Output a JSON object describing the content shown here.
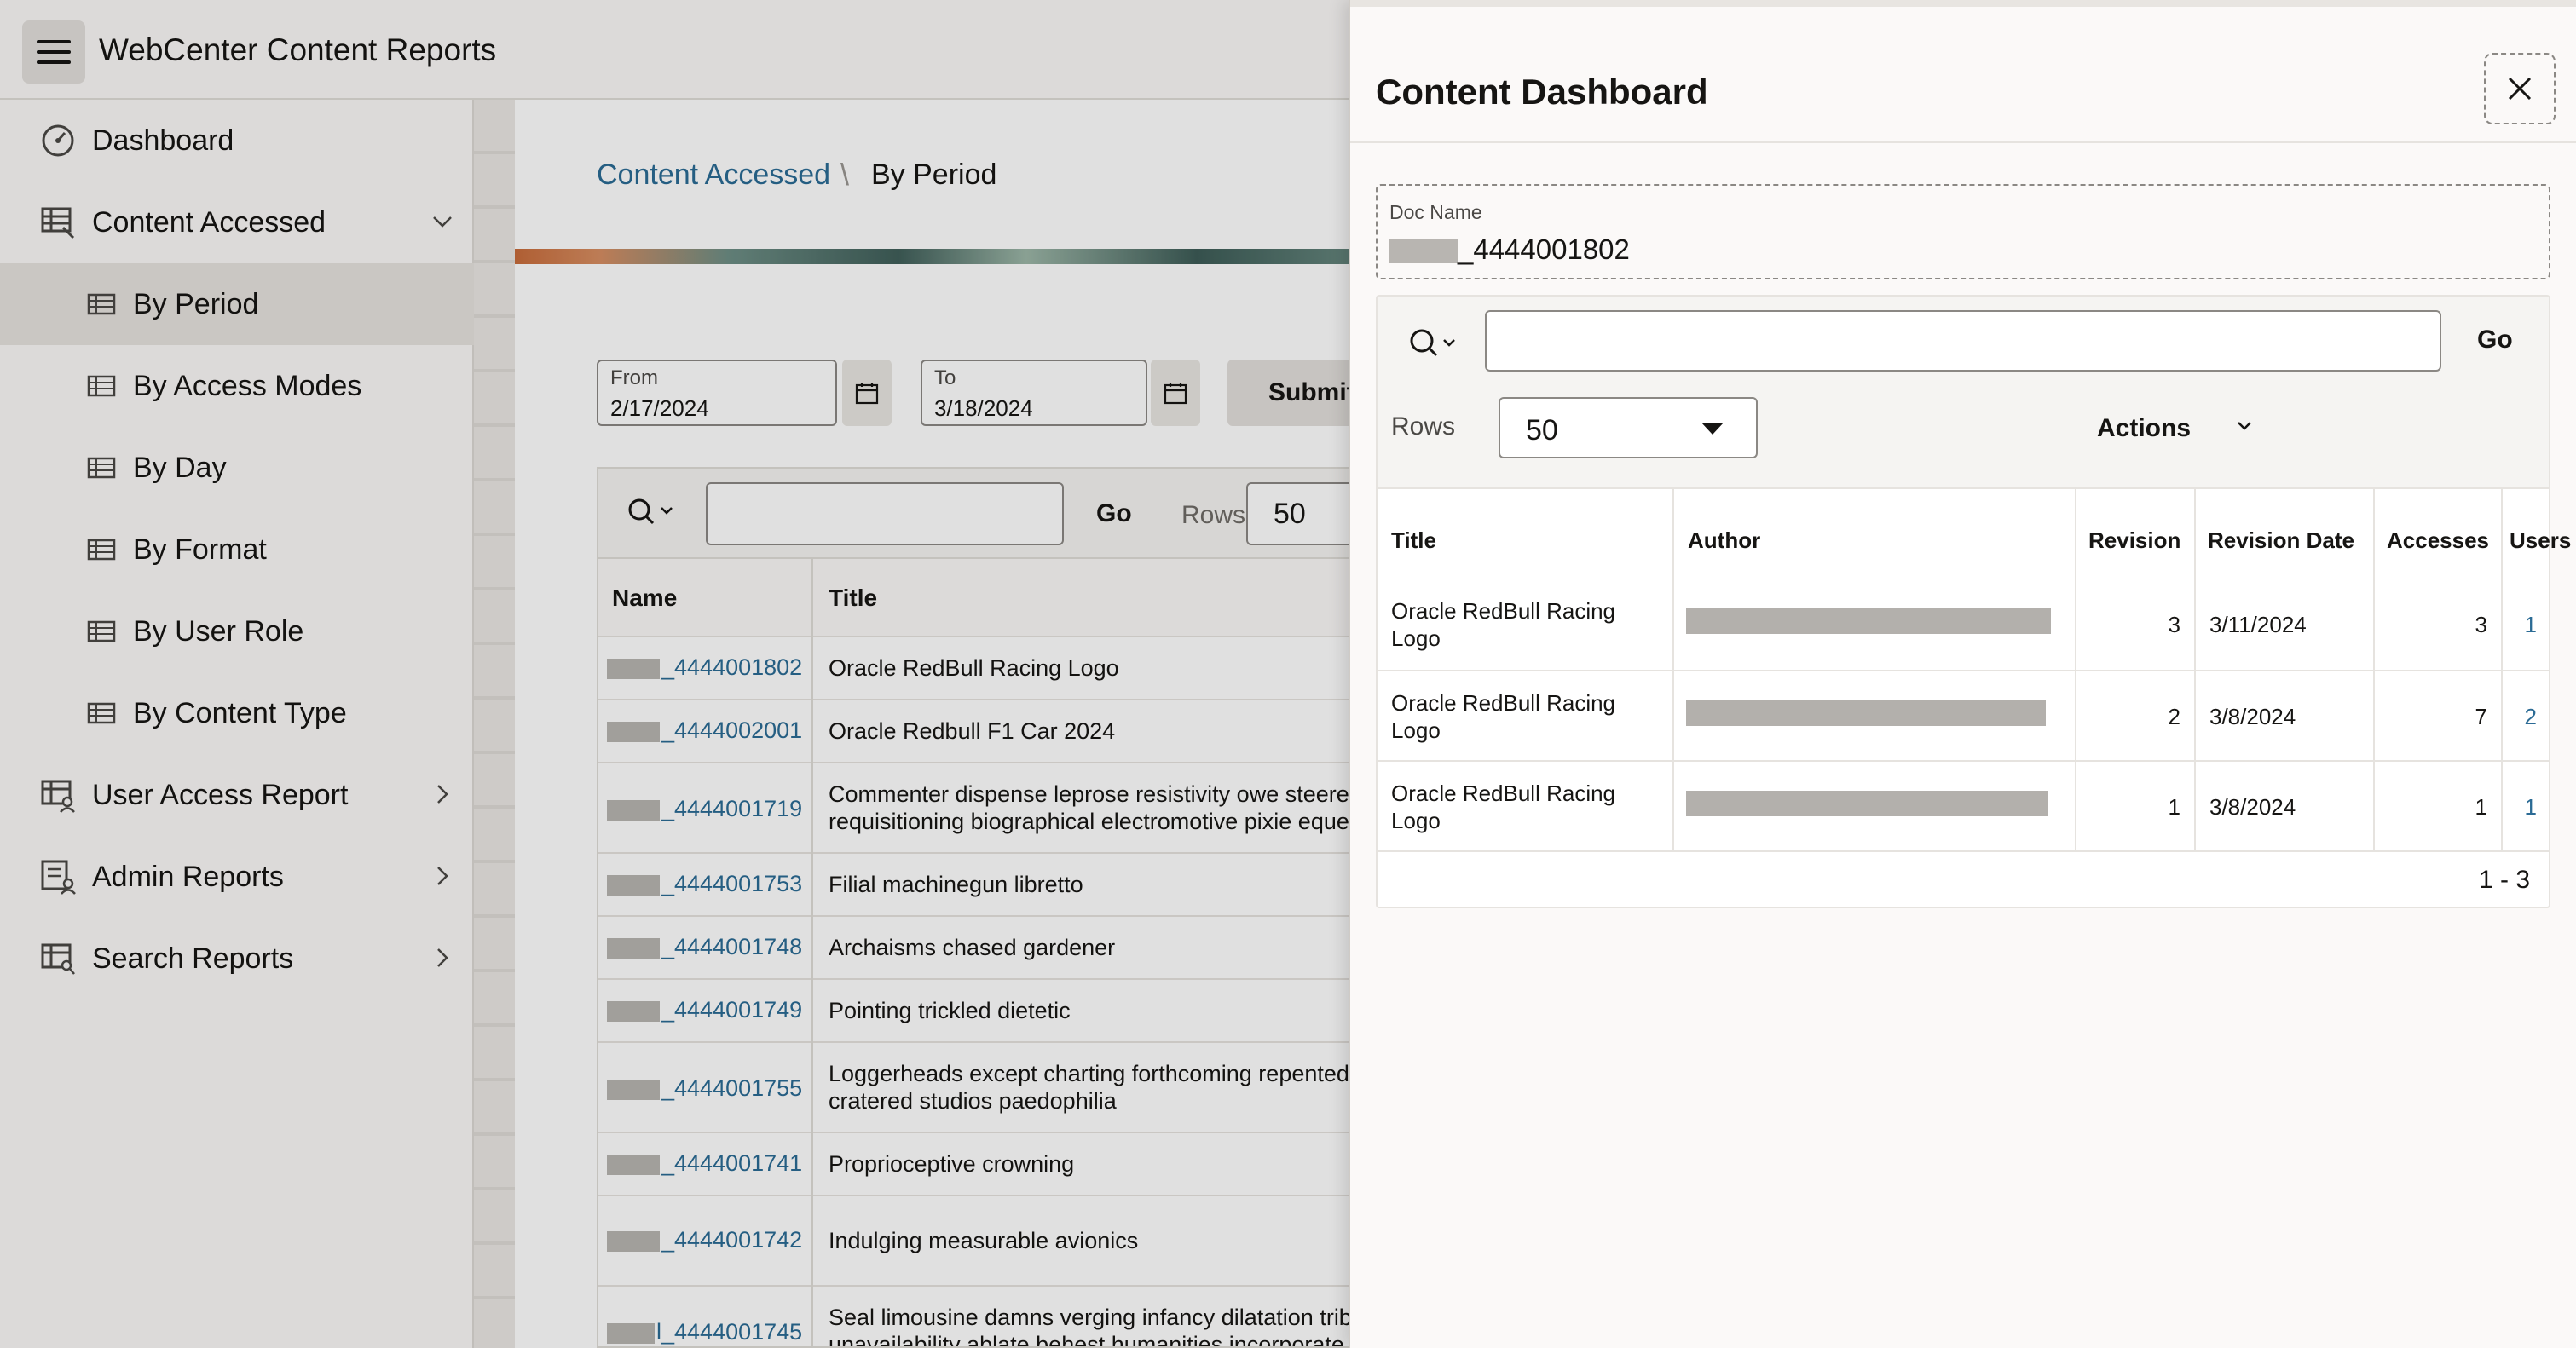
{
  "app": {
    "title": "WebCenter Content Reports"
  },
  "sidebar": {
    "items": [
      {
        "label": "Dashboard"
      },
      {
        "label": "Content Accessed"
      },
      {
        "label": "By Period"
      },
      {
        "label": "By Access Modes"
      },
      {
        "label": "By Day"
      },
      {
        "label": "By Format"
      },
      {
        "label": "By User Role"
      },
      {
        "label": "By Content Type"
      },
      {
        "label": "User Access Report"
      },
      {
        "label": "Admin Reports"
      },
      {
        "label": "Search Reports"
      }
    ]
  },
  "breadcrumb": {
    "parent": "Content Accessed",
    "separator": "\\",
    "current": "By Period"
  },
  "filters": {
    "from_label": "From",
    "from_value": "2/17/2024",
    "to_label": "To",
    "to_value": "3/18/2024",
    "submit_label": "Submit"
  },
  "grid": {
    "go_label": "Go",
    "rows_label": "Rows",
    "rows_value": "50",
    "columns": [
      "Name",
      "Title"
    ],
    "rows": [
      {
        "name": "_4444001802",
        "title": "Oracle RedBull Racing Logo"
      },
      {
        "name": "_4444002001",
        "title": "Oracle Redbull F1 Car 2024"
      },
      {
        "name": "_4444001719",
        "title": "Commenter dispense leprose resistivity owe steered in",
        "title2": "requisitioning biographical electromotive pixie equestr"
      },
      {
        "name": "_4444001753",
        "title": "Filial machinegun libretto"
      },
      {
        "name": "_4444001748",
        "title": "Archaisms chased gardener"
      },
      {
        "name": "_4444001749",
        "title": "Pointing trickled dietetic"
      },
      {
        "name": "_4444001755",
        "title": "Loggerheads except charting forthcoming repented ti",
        "title2": "cratered studios paedophilia"
      },
      {
        "name": "_4444001741",
        "title": "Proprioceptive crowning"
      },
      {
        "name": "_4444001742",
        "title": "Indulging measurable avionics"
      },
      {
        "name": "l_4444001745",
        "title": "Seal limousine damns verging infancy dilatation tribes",
        "title2": "unavailability ablate behest humanities incorporate fila"
      }
    ]
  },
  "drawer": {
    "title": "Content Dashboard",
    "doc_name_label": "Doc Name",
    "doc_name_value": "_4444001802",
    "go_label": "Go",
    "rows_label": "Rows",
    "rows_value": "50",
    "actions_label": "Actions",
    "columns": [
      "Title",
      "Author",
      "Revision",
      "Revision Date",
      "Accesses",
      "Users"
    ],
    "rows": [
      {
        "title": "Oracle RedBull Racing Logo",
        "revision": "3",
        "revision_date": "3/11/2024",
        "accesses": "3",
        "users": "1"
      },
      {
        "title": "Oracle RedBull Racing Logo",
        "revision": "2",
        "revision_date": "3/8/2024",
        "accesses": "7",
        "users": "2"
      },
      {
        "title": "Oracle RedBull Racing Logo",
        "revision": "1",
        "revision_date": "3/8/2024",
        "accesses": "1",
        "users": "1"
      }
    ],
    "pager": "1 - 3"
  },
  "colors": {
    "link": "#2b6b95",
    "accent_text": "#161513",
    "sidebar_active": "#e6e3df"
  }
}
